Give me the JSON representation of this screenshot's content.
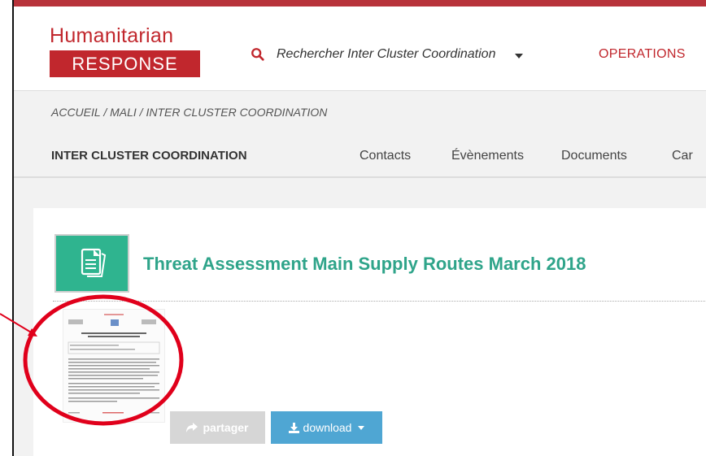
{
  "header": {
    "logo_top": "Humanitarian",
    "logo_bottom": "RESPONSE",
    "search_text": "Rechercher Inter Cluster Coordination",
    "operations": "OPERATIONS"
  },
  "breadcrumb": "ACCUEIL  / MALI / INTER CLUSTER COORDINATION",
  "subnav": {
    "title": "INTER CLUSTER COORDINATION",
    "tabs": [
      "Contacts",
      "Évènements",
      "Documents",
      "Car"
    ]
  },
  "document": {
    "title": "Threat Assessment Main Supply Routes March 2018",
    "share_label": "partager",
    "download_label": "download"
  },
  "colors": {
    "brand_red": "#c1272d",
    "teal": "#2fa48a",
    "button_blue": "#4fa6d3",
    "annotation_red": "#e0001b"
  }
}
